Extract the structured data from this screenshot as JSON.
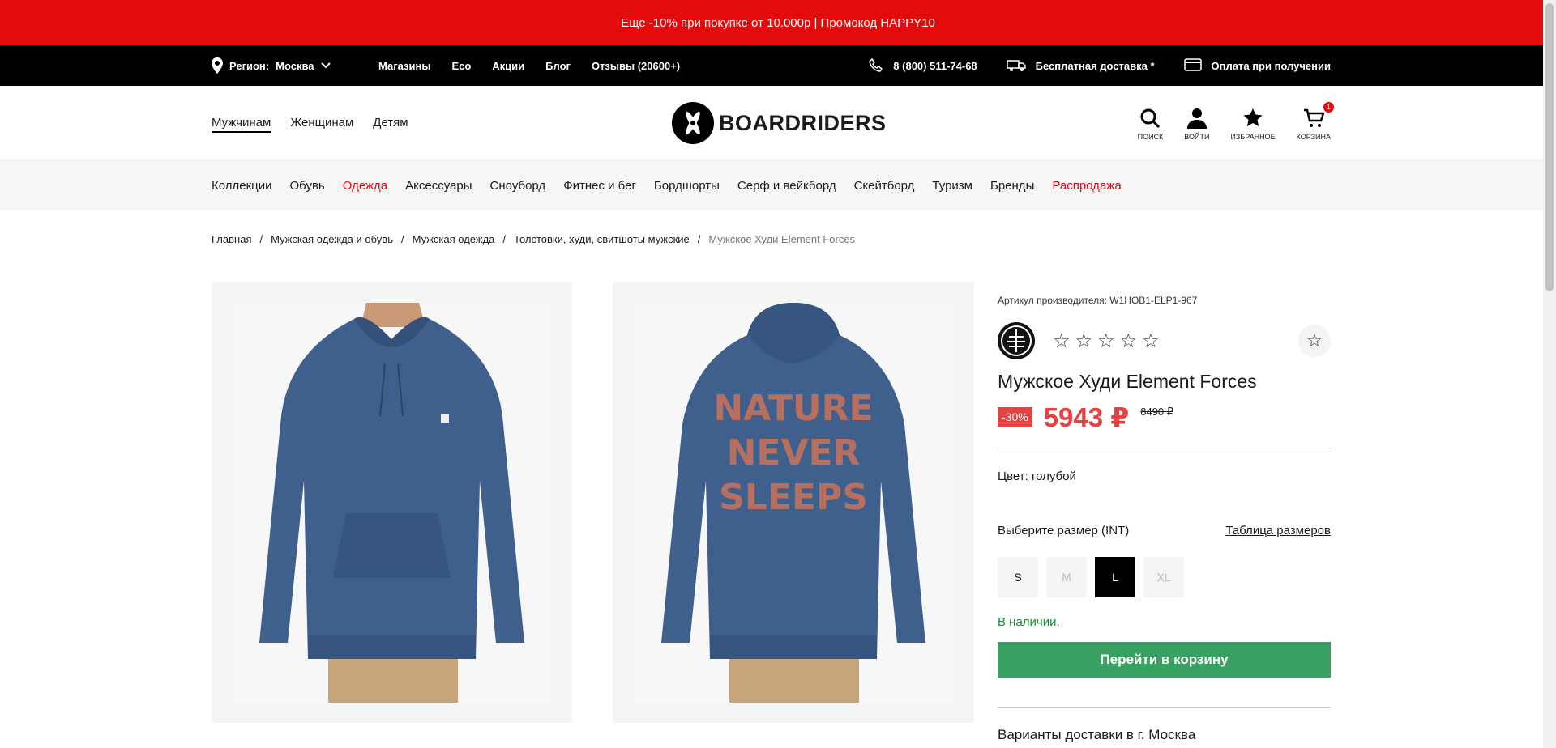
{
  "promo": {
    "text": "Еще -10% при покупке от 10.000р | Промокод HAPPY10"
  },
  "topbar": {
    "region_label": "Регион:",
    "region_value": "Москва",
    "links": [
      "Магазины",
      "Eco",
      "Акции",
      "Блог",
      "Отзывы (20600+)"
    ],
    "phone": "8 (800) 511-74-68",
    "delivery": "Бесплатная доставка *",
    "payment": "Оплата при получении"
  },
  "header": {
    "gender": [
      "Мужчинам",
      "Женщинам",
      "Детям"
    ],
    "logo_text": "BOARDRIDERS",
    "icons": {
      "search": "ПОИСК",
      "login": "ВОЙТИ",
      "favorites": "ИЗБРАННОЕ",
      "cart": "КОРЗИНА",
      "cart_count": "1"
    }
  },
  "catnav": [
    "Коллекции",
    "Обувь",
    "Одежда",
    "Аксессуары",
    "Сноуборд",
    "Фитнес и бег",
    "Бордшорты",
    "Серф и вейкборд",
    "Скейтборд",
    "Туризм",
    "Бренды",
    "Распродажа"
  ],
  "breadcrumbs": [
    "Главная",
    "Мужская одежда и обувь",
    "Мужская одежда",
    "Толстовки, худи, свитшоты мужские",
    "Мужское Худи Element Forces"
  ],
  "product": {
    "sku": "Артикул производителя: W1HOB1-ELP1-967",
    "title": "Мужское Худи Element Forces",
    "discount": "-30%",
    "price": "5943 ₽",
    "old_price": "8490 ₽",
    "color": "Цвет: голубой",
    "size_label": "Выберите размер (INT)",
    "size_table": "Таблица размеров",
    "sizes": [
      "S",
      "M",
      "L",
      "XL"
    ],
    "stock": "В наличии.",
    "cart_button": "Перейти в корзину",
    "delivery_title": "Варианты доставки в г. Москва",
    "back_print": [
      "NATURE",
      "NEVER",
      "SLEEPS"
    ]
  },
  "colors": {
    "promo": "#e30b0b",
    "price": "#e84141",
    "cart_button": "#38a061",
    "hoodie": "#3f5f8c",
    "in_stock": "#1e8c3a"
  }
}
